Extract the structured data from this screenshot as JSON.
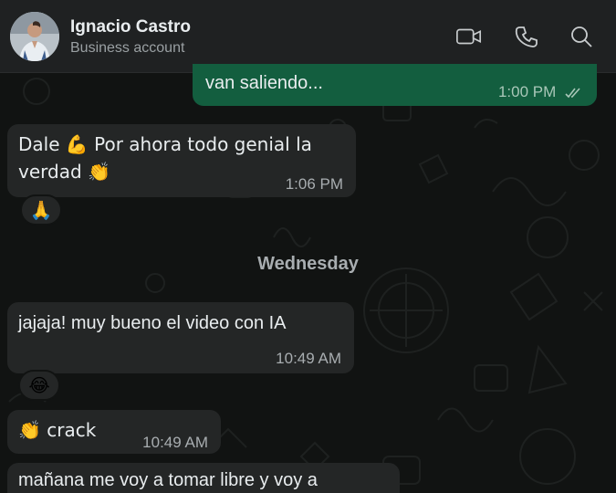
{
  "header": {
    "contact_name": "Ignacio Castro",
    "contact_subtitle": "Business account",
    "video_call_icon": "video-camera-icon",
    "voice_call_icon": "phone-icon",
    "search_icon": "search-icon"
  },
  "messages": [
    {
      "direction": "out",
      "text": "van saliendo...",
      "time": "1:00 PM",
      "status": "read"
    },
    {
      "direction": "in",
      "line1": "Dale 💪 Por ahora todo genial la",
      "line2": "verdad 👏",
      "time": "1:06 PM",
      "reaction": "🙏"
    },
    {
      "direction": "in",
      "text": "jajaja! muy bueno el video con IA",
      "time": "10:49 AM",
      "reaction": "😂"
    },
    {
      "direction": "in",
      "text": "👏 crack",
      "time": "10:49 AM"
    },
    {
      "direction": "in",
      "text": "mañana me voy a tomar libre y voy a"
    }
  ],
  "day_divider": "Wednesday",
  "colors": {
    "outgoing_bubble": "#135e3f",
    "incoming_bubble": "#242626",
    "header_bg": "#1f2122"
  }
}
